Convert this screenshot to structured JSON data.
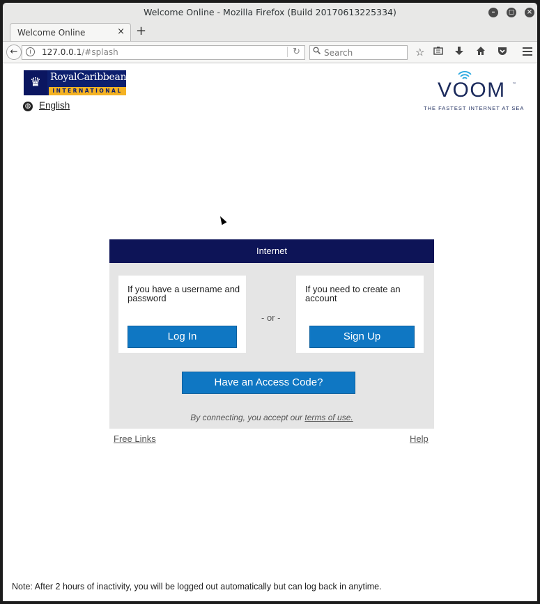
{
  "window": {
    "title": "Welcome Online - Mozilla Firefox (Build 20170613225334)",
    "controls": {
      "minimize": "–",
      "maximize": "◻",
      "close": "×"
    }
  },
  "tabs": [
    {
      "label": "Welcome Online",
      "close": "×"
    }
  ],
  "new_tab": "+",
  "nav": {
    "url_host": "127.0.0.1",
    "url_path": "/#splash",
    "search_placeholder": "Search",
    "icons": [
      "back-icon",
      "info-icon",
      "reload-icon",
      "search-icon",
      "bookmark-star-icon",
      "reader-icon",
      "download-icon",
      "home-icon",
      "pocket-icon",
      "menu-icon"
    ]
  },
  "page": {
    "logo_left": {
      "word": "RoyalCaribbean",
      "band": "INTERNATIONAL"
    },
    "language": "English",
    "logo_right": {
      "word": "VOOM",
      "tm": "™",
      "tagline": "THE FASTEST INTERNET AT SEA"
    },
    "panel": {
      "header": "Internet",
      "login_card": {
        "text": "If you have a username and password",
        "button": "Log In"
      },
      "or": "- or -",
      "signup_card": {
        "text": "If you need to create an account",
        "button": "Sign Up"
      },
      "access_code_button": "Have an Access Code?",
      "terms_prefix": "By connecting, you accept our ",
      "terms_link": "terms of use."
    },
    "free_links": "Free Links",
    "help": "Help",
    "note": "Note: After 2 hours of inactivity, you will be logged out automatically but can log back in anytime."
  },
  "colors": {
    "panel_header": "#0d1457",
    "button": "#0f77c3",
    "panel_bg": "#e5e5e5",
    "brand_navy": "#1b2a5c",
    "brand_gold": "#f4b223"
  }
}
